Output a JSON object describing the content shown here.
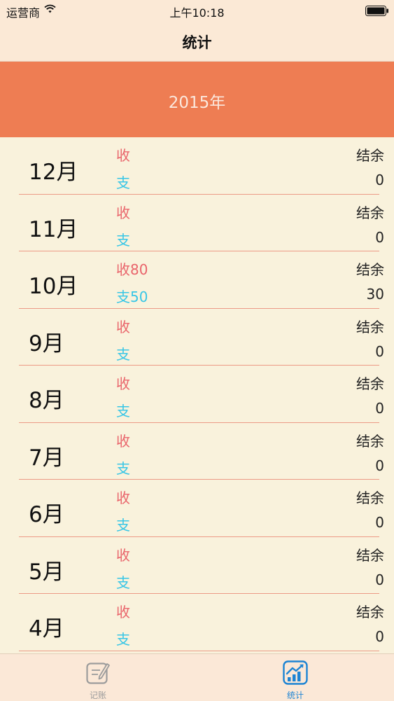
{
  "status_bar": {
    "carrier": "运营商",
    "time": "上午10:18",
    "wifi_icon": "wifi-icon",
    "battery_icon": "battery-icon"
  },
  "nav": {
    "title": "统计"
  },
  "year": {
    "title": "2015年"
  },
  "months": [
    {
      "label": "12月",
      "income": "收",
      "expense": "支",
      "balance_label": "结余",
      "balance": "0"
    },
    {
      "label": "11月",
      "income": "收",
      "expense": "支",
      "balance_label": "结余",
      "balance": "0"
    },
    {
      "label": "10月",
      "income": "收80",
      "expense": "支50",
      "balance_label": "结余",
      "balance": "30"
    },
    {
      "label": "9月",
      "income": "收",
      "expense": "支",
      "balance_label": "结余",
      "balance": "0"
    },
    {
      "label": "8月",
      "income": "收",
      "expense": "支",
      "balance_label": "结余",
      "balance": "0"
    },
    {
      "label": "7月",
      "income": "收",
      "expense": "支",
      "balance_label": "结余",
      "balance": "0"
    },
    {
      "label": "6月",
      "income": "收",
      "expense": "支",
      "balance_label": "结余",
      "balance": "0"
    },
    {
      "label": "5月",
      "income": "收",
      "expense": "支",
      "balance_label": "结余",
      "balance": "0"
    },
    {
      "label": "4月",
      "income": "收",
      "expense": "支",
      "balance_label": "结余",
      "balance": "0"
    }
  ],
  "tabs": [
    {
      "label": "记账",
      "icon": "edit-icon",
      "active": false
    },
    {
      "label": "统计",
      "icon": "chart-icon",
      "active": true
    }
  ],
  "colors": {
    "banner": "#ee7d53",
    "income": "#e9646b",
    "expense": "#38c6e6",
    "divider": "#ec9a86",
    "active_tab": "#1d84d4",
    "background": "#f9f2dc"
  }
}
